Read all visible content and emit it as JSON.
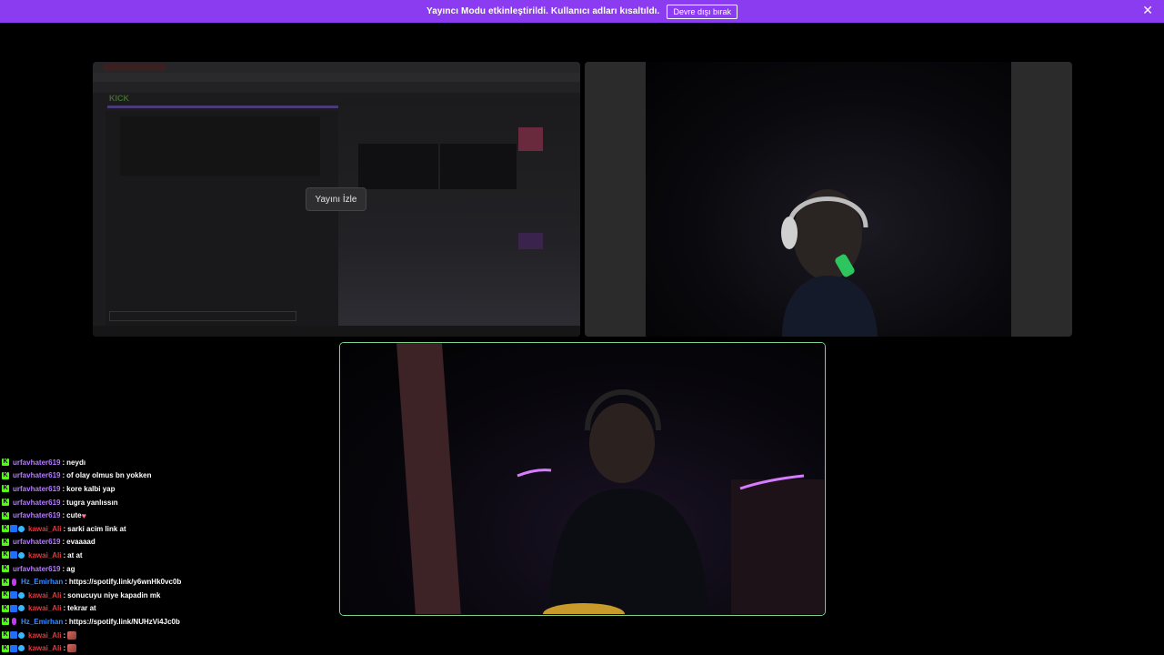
{
  "banner": {
    "text": "Yayıncı Modu etkinleştirildi. Kullanıcı adları kısaltıldı.",
    "button_label": "Devre dışı bırak",
    "close_glyph": "✕"
  },
  "screen_share": {
    "logo_text": "KICK",
    "watch_button_label": "Yayını İzle"
  },
  "colors": {
    "banner": "#8b3cf0",
    "kick_green": "#53fc18",
    "active_speaker_border": "#7fd08c",
    "user_purple": "#b57bff",
    "user_red": "#e2393f",
    "user_blue": "#3d8bff"
  },
  "chat": {
    "messages": [
      {
        "badges": [
          "kick"
        ],
        "user": "urfavhater619",
        "color": "#b57bff",
        "text": "neydı"
      },
      {
        "badges": [
          "kick"
        ],
        "user": "urfavhater619",
        "color": "#b57bff",
        "text": "of olay olmus bn yokken"
      },
      {
        "badges": [
          "kick"
        ],
        "user": "urfavhater619",
        "color": "#b57bff",
        "text": "kore kalbi yap"
      },
      {
        "badges": [
          "kick"
        ],
        "user": "urfavhater619",
        "color": "#b57bff",
        "text": "tugra yanlıssın"
      },
      {
        "badges": [
          "kick"
        ],
        "user": "urfavhater619",
        "color": "#b57bff",
        "text": "cute",
        "emoji": "heart"
      },
      {
        "badges": [
          "kick",
          "mod",
          "gem"
        ],
        "user": "kawai_Ali",
        "color": "#e2393f",
        "text": "sarki acim link at"
      },
      {
        "badges": [
          "kick"
        ],
        "user": "urfavhater619",
        "color": "#b57bff",
        "text": "evaaaad"
      },
      {
        "badges": [
          "kick",
          "mod",
          "gem"
        ],
        "user": "kawai_Ali",
        "color": "#e2393f",
        "text": "at at"
      },
      {
        "badges": [
          "kick"
        ],
        "user": "urfavhater619",
        "color": "#b57bff",
        "text": "ag"
      },
      {
        "badges": [
          "kick",
          "mic"
        ],
        "user": "Hz_Emirhan",
        "color": "#3d8bff",
        "text": "https://spotify.link/y6wnHk0vc0b"
      },
      {
        "badges": [
          "kick",
          "mod",
          "gem"
        ],
        "user": "kawai_Ali",
        "color": "#e2393f",
        "text": "sonucuyu niye kapadin mk"
      },
      {
        "badges": [
          "kick",
          "mod",
          "gem"
        ],
        "user": "kawai_Ali",
        "color": "#e2393f",
        "text": "tekrar at"
      },
      {
        "badges": [
          "kick",
          "mic"
        ],
        "user": "Hz_Emirhan",
        "color": "#3d8bff",
        "text": "https://spotify.link/NUHzVi4Jc0b"
      },
      {
        "badges": [
          "kick",
          "mod",
          "gem"
        ],
        "user": "kawai_Ali",
        "color": "#e2393f",
        "text": "",
        "emoji": "emote"
      },
      {
        "badges": [
          "kick",
          "mod",
          "gem"
        ],
        "user": "kawai_Ali",
        "color": "#e2393f",
        "text": "",
        "emoji": "emote"
      }
    ]
  }
}
